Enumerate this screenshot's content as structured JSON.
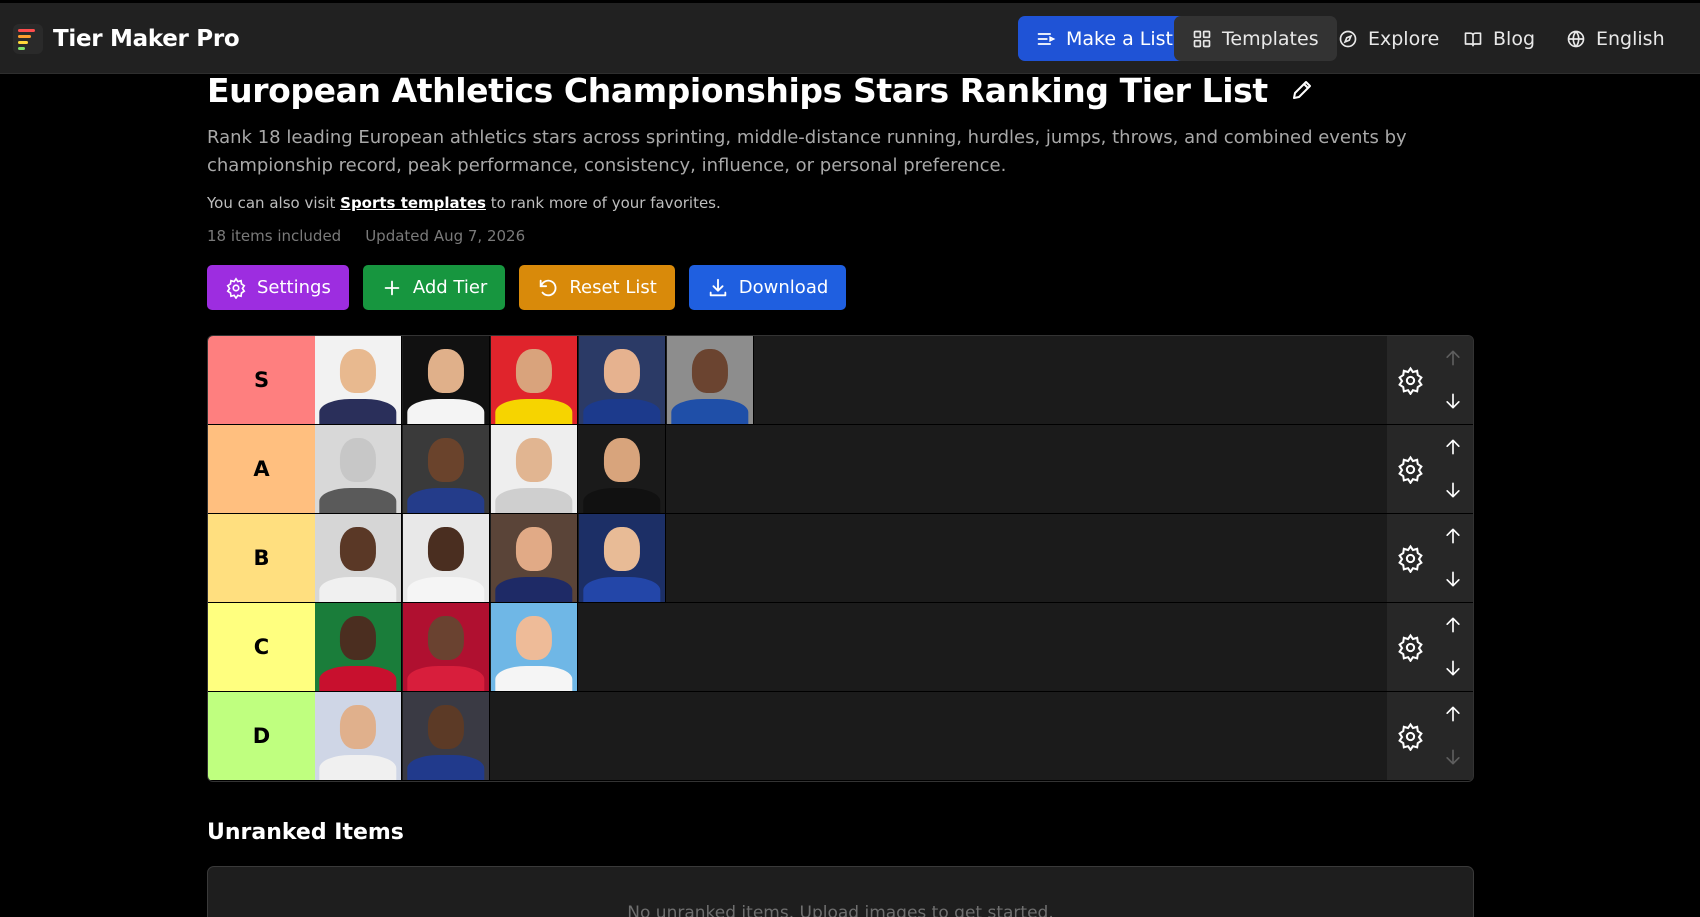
{
  "header": {
    "brand": "Tier Maker Pro",
    "nav": [
      {
        "label": "Make a List",
        "icon": "list-icon"
      },
      {
        "label": "Templates",
        "icon": "grid-icon"
      },
      {
        "label": "Explore",
        "icon": "compass-icon"
      },
      {
        "label": "Blog",
        "icon": "book-icon"
      },
      {
        "label": "English",
        "icon": "globe-icon"
      }
    ]
  },
  "page": {
    "title": "European Athletics Championships Stars Ranking Tier List",
    "description": "Rank 18 leading European athletics stars across sprinting, middle-distance running, hurdles, jumps, throws, and combined events by championship record, peak performance, consistency, influence, or personal preference.",
    "visit_prefix": "You can also visit ",
    "visit_link": "Sports templates",
    "visit_suffix": " to rank more of your favorites.",
    "items_count": "18 items included",
    "updated": "Updated Aug 7, 2026"
  },
  "actions": [
    {
      "label": "Settings",
      "icon": "gear-icon",
      "color": "#9d2de0"
    },
    {
      "label": "Add Tier",
      "icon": "plus-icon",
      "color": "#17963f"
    },
    {
      "label": "Reset List",
      "icon": "reset-icon",
      "color": "#d98a0a"
    },
    {
      "label": "Download",
      "icon": "download-icon",
      "color": "#1f5fe0"
    }
  ],
  "tiers": [
    {
      "label": "S",
      "color": "#fe7f7f",
      "item_count": 5
    },
    {
      "label": "A",
      "color": "#ffbf7f",
      "item_count": 4
    },
    {
      "label": "B",
      "color": "#ffdf7f",
      "item_count": 4
    },
    {
      "label": "C",
      "color": "#ffff7f",
      "item_count": 3
    },
    {
      "label": "D",
      "color": "#bfff7f",
      "item_count": 2
    }
  ],
  "unranked": {
    "title": "Unranked Items",
    "empty_message": "No unranked items. Upload images to get started."
  }
}
